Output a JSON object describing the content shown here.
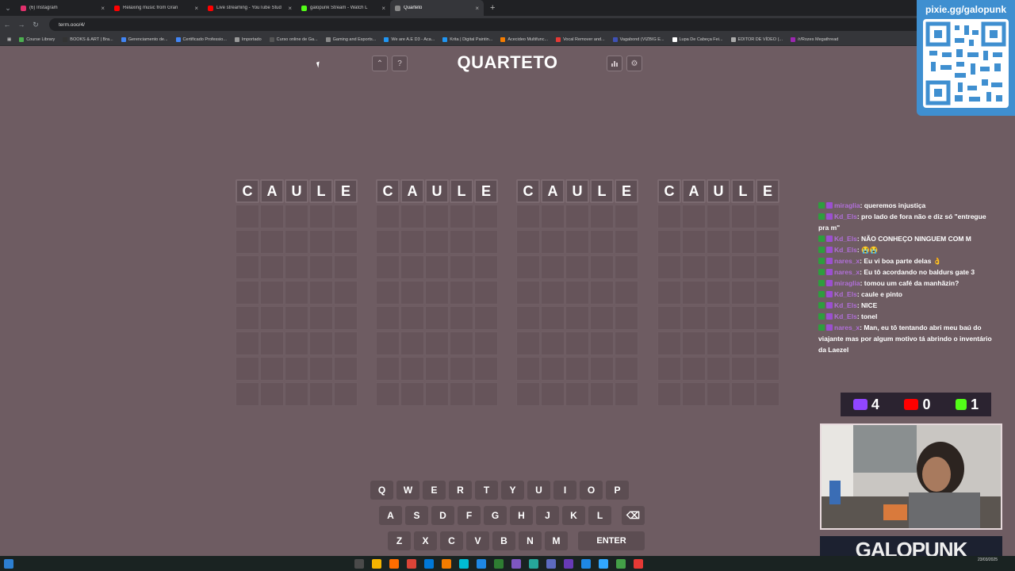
{
  "browser": {
    "tabs": [
      {
        "title": "(6) Instagram",
        "color": "#e1306c"
      },
      {
        "title": "Relaxing music from Gran",
        "color": "#ff0000"
      },
      {
        "title": "Live streaming - YouTube Stud",
        "color": "#ff0000"
      },
      {
        "title": "galopunk Stream - Watch L",
        "color": "#53fc18"
      },
      {
        "title": "Quarteto",
        "color": "#888888"
      }
    ],
    "url": "term.ooo/4/",
    "bookmarks": [
      "Course Library",
      "BOOKS & ART | Bra...",
      "Gerenciamento de...",
      "Certificado Professio...",
      "Importado",
      "Curso online de Ga...",
      "Gaming and Esports...",
      "We are A.E D3 - Aca...",
      "Krita | Digital Paintin...",
      "Acecideo Multifunc...",
      "Vocal Remover and...",
      "Vagabond (VIZBIG E...",
      "Lupa De Cabeça Fei...",
      "EDITOR DE VÍDEO (...",
      "/r/Rozes Megathread"
    ]
  },
  "game": {
    "title": "QUARTETO",
    "header_icons": [
      "arrow-up-icon",
      "help-icon",
      "stats-icon",
      "gear-icon"
    ],
    "help_symbol": "?",
    "boards": [
      {
        "guess": [
          "C",
          "A",
          "U",
          "L",
          "E"
        ]
      },
      {
        "guess": [
          "C",
          "A",
          "U",
          "L",
          "E"
        ]
      },
      {
        "guess": [
          "C",
          "A",
          "U",
          "L",
          "E"
        ]
      },
      {
        "guess": [
          "C",
          "A",
          "U",
          "L",
          "E"
        ]
      }
    ],
    "keyboard": {
      "row1": [
        "Q",
        "W",
        "E",
        "R",
        "T",
        "Y",
        "U",
        "I",
        "O",
        "P"
      ],
      "row2": [
        "A",
        "S",
        "D",
        "F",
        "G",
        "H",
        "J",
        "K",
        "L"
      ],
      "row3": [
        "Z",
        "X",
        "C",
        "V",
        "B",
        "N",
        "M"
      ],
      "enter_label": "ENTER",
      "backspace_icon": "backspace-icon"
    }
  },
  "overlay": {
    "qr_label": "pixie.gg/galopunk",
    "chat": [
      {
        "user": "miraglia",
        "text": ": queremos injustiça"
      },
      {
        "user": "Kd_Els",
        "text": ": pro lado de fora não e diz só \"entregue pra m\""
      },
      {
        "user": "Kd_Els",
        "text": ": NÃO CONHEÇO NINGUEM COM M"
      },
      {
        "user": "Kd_Els",
        "text": ": 😭😭"
      },
      {
        "user": "nares_x",
        "text": ": Eu vi boa parte delas 👌"
      },
      {
        "user": "nares_x",
        "text": ": Eu tô acordando no baldurs gate 3"
      },
      {
        "user": "miraglia",
        "text": ": tomou um café da manhãzin?"
      },
      {
        "user": "Kd_Els",
        "text": ": caule e pinto"
      },
      {
        "user": "Kd_Els",
        "text": ": NICE"
      },
      {
        "user": "Kd_Els",
        "text": ": tonel"
      },
      {
        "user": "nares_x",
        "text": ": Man, eu tô tentando abri meu baú do viajante mas por algum motivo tá abrindo o inventário da Laezel"
      }
    ],
    "viewers": {
      "twitch": "4",
      "youtube": "0",
      "kick": "1"
    },
    "brand": "GALOPUNK"
  },
  "taskbar": {
    "time": "23/03/2025"
  }
}
